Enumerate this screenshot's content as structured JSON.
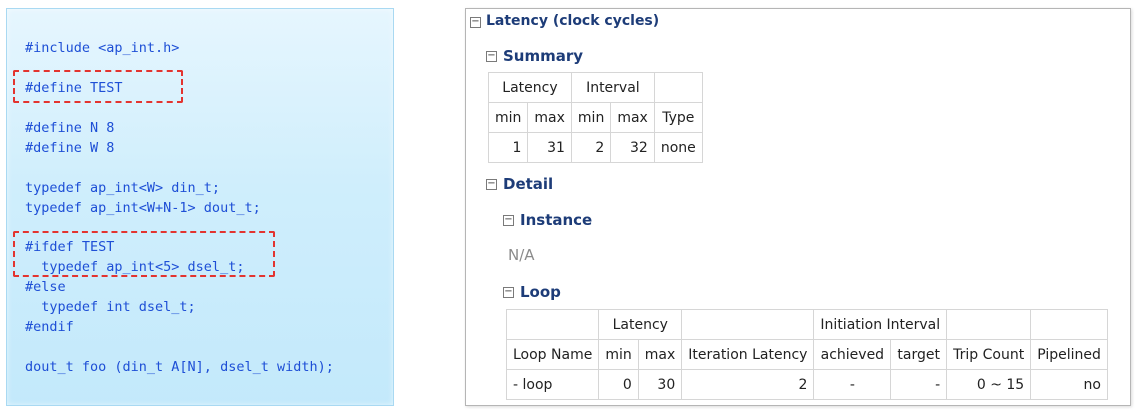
{
  "code": {
    "lines": [
      "#include <ap_int.h>",
      "#define TEST",
      "#define N 8",
      "#define W 8",
      "typedef ap_int<W> din_t;",
      "typedef ap_int<W+N-1> dout_t;",
      "#ifdef TEST",
      "  typedef ap_int<5> dsel_t;",
      "#else",
      "  typedef int dsel_t;",
      "#endif",
      "dout_t foo (din_t A[N], dsel_t width);"
    ],
    "highlight_color": "#e3342f",
    "text_color": "#1e4fd6"
  },
  "report": {
    "title": "Latency (clock cycles)",
    "summary": {
      "title": "Summary",
      "group_headers": [
        "Latency",
        "Interval",
        ""
      ],
      "col_headers": [
        "min",
        "max",
        "min",
        "max",
        "Type"
      ],
      "row": [
        "1",
        "31",
        "2",
        "32",
        "none"
      ]
    },
    "detail": {
      "title": "Detail",
      "instance": {
        "title": "Instance",
        "value": "N/A"
      },
      "loop": {
        "title": "Loop",
        "group_headers": [
          "",
          "Latency",
          "",
          "Initiation Interval",
          "",
          ""
        ],
        "col_headers": [
          "Loop Name",
          "min",
          "max",
          "Iteration Latency",
          "achieved",
          "target",
          "Trip Count",
          "Pipelined"
        ],
        "row": [
          "- loop",
          "0",
          "30",
          "2",
          "-",
          "-",
          "0 ~ 15",
          "no"
        ]
      }
    },
    "toggle_symbol": "⊟",
    "title_color": "#1d3c78"
  }
}
